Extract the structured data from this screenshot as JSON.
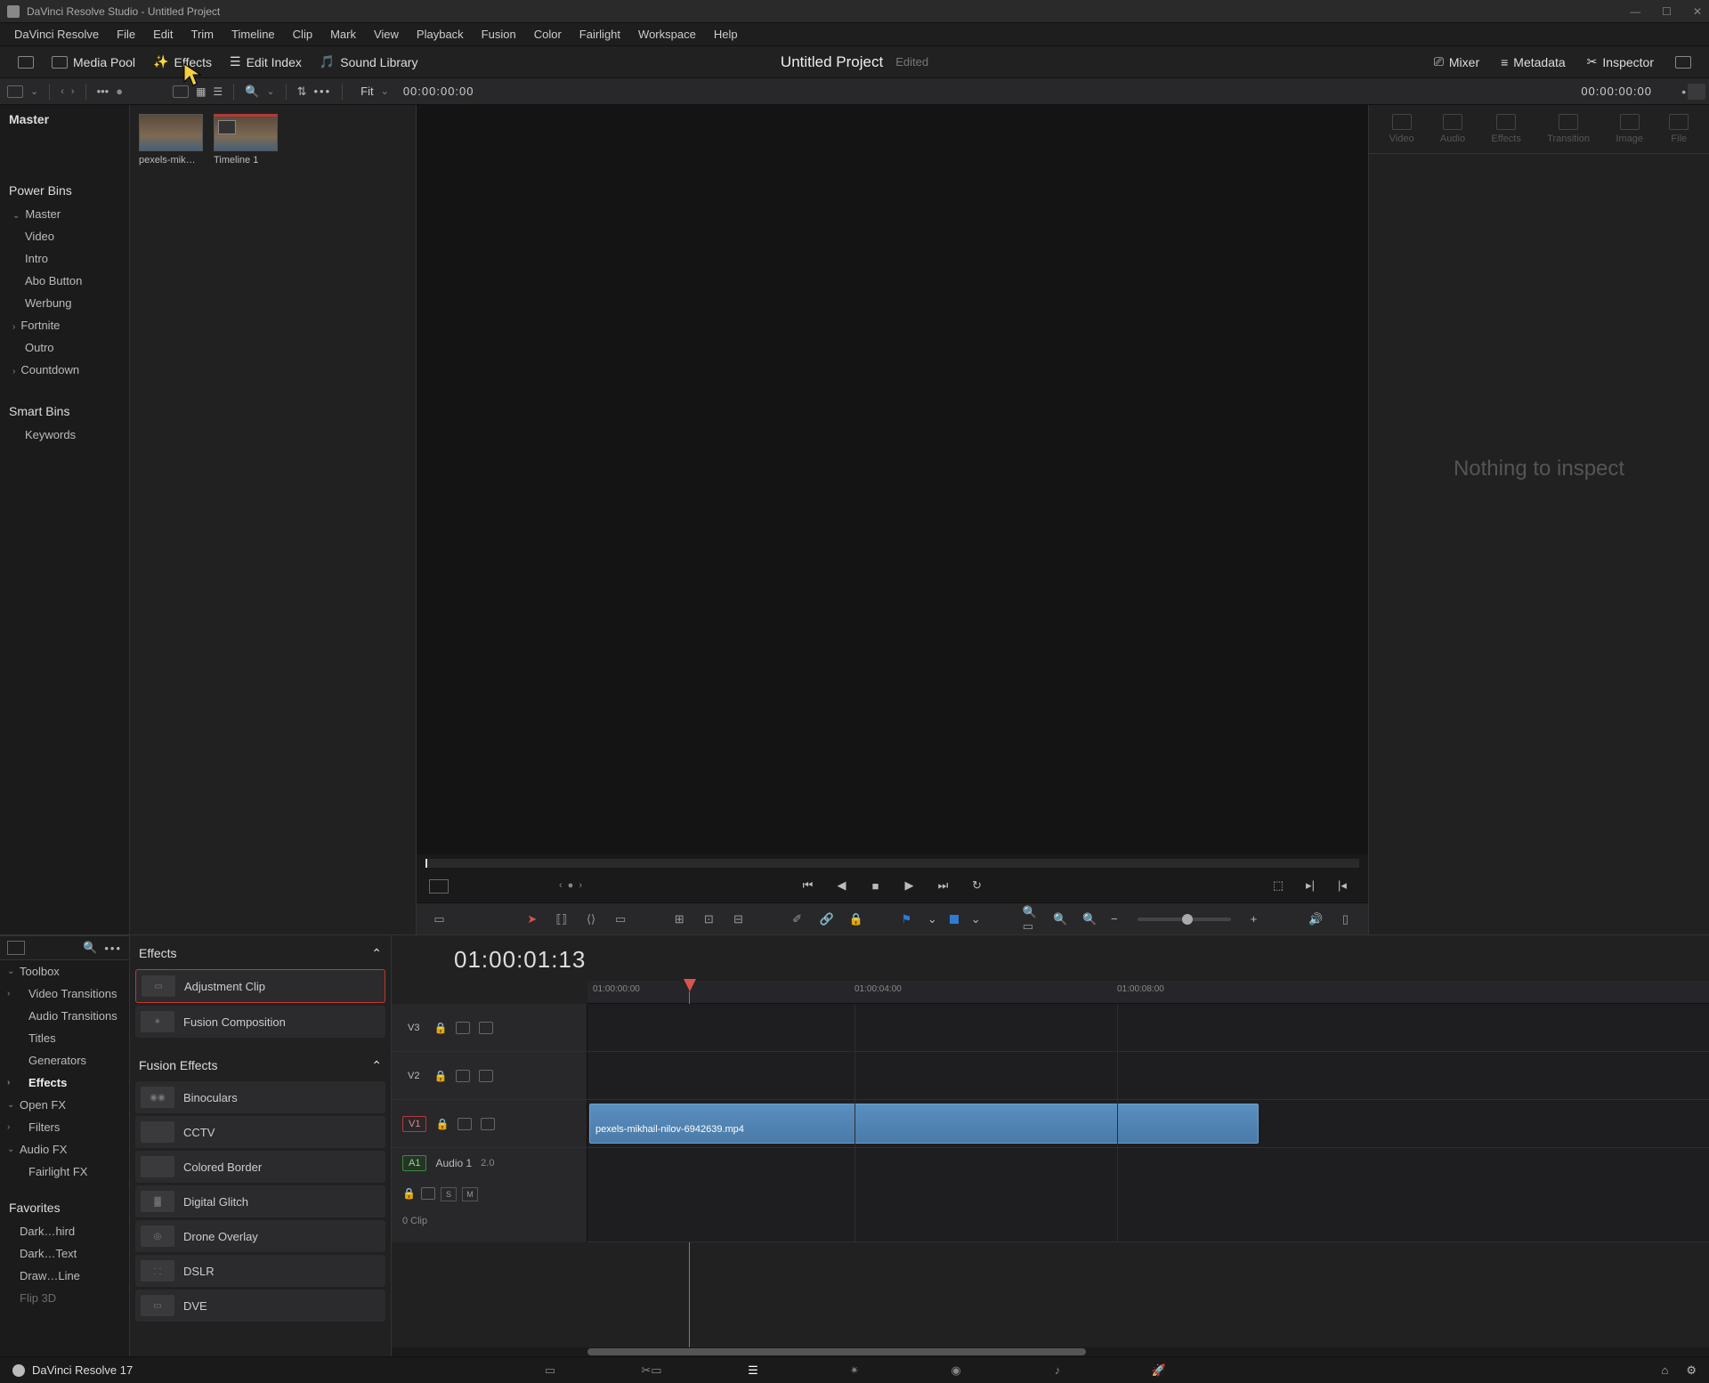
{
  "window": {
    "title": "DaVinci Resolve Studio - Untitled Project"
  },
  "menubar": [
    "DaVinci Resolve",
    "File",
    "Edit",
    "Trim",
    "Timeline",
    "Clip",
    "Mark",
    "View",
    "Playback",
    "Fusion",
    "Color",
    "Fairlight",
    "Workspace",
    "Help"
  ],
  "toolrow": {
    "media_pool": "Media Pool",
    "effects": "Effects",
    "edit_index": "Edit Index",
    "sound_library": "Sound Library",
    "project_title": "Untitled Project",
    "edited": "Edited",
    "mixer": "Mixer",
    "metadata": "Metadata",
    "inspector": "Inspector"
  },
  "toolrow2": {
    "fit": "Fit",
    "timecode_left": "00:00:00:00",
    "timecode_right": "00:00:00:00"
  },
  "bins": {
    "master": "Master",
    "power_bins": "Power Bins",
    "items": [
      "Master",
      "Video",
      "Intro",
      "Abo Button",
      "Werbung",
      "Fortnite",
      "Outro",
      "Countdown"
    ],
    "smart_bins": "Smart Bins",
    "keywords": "Keywords"
  },
  "thumbs": [
    {
      "label": "pexels-mik…"
    },
    {
      "label": "Timeline 1"
    }
  ],
  "inspector": {
    "tabs": [
      "Video",
      "Audio",
      "Effects",
      "Transition",
      "Image",
      "File"
    ],
    "empty": "Nothing to inspect"
  },
  "fxside": {
    "toolbox": "Toolbox",
    "items": [
      "Video Transitions",
      "Audio Transitions",
      "Titles",
      "Generators",
      "Effects"
    ],
    "openfx": "Open FX",
    "filters": "Filters",
    "audiofx": "Audio FX",
    "fairlight": "Fairlight FX",
    "favorites": "Favorites",
    "favs": [
      "Dark…hird",
      "Dark…Text",
      "Draw…Line",
      "Flip 3D"
    ]
  },
  "fxlist": {
    "section1": "Effects",
    "section2": "Fusion Effects",
    "effects": [
      "Adjustment Clip",
      "Fusion Composition"
    ],
    "fusion": [
      "Binoculars",
      "CCTV",
      "Colored Border",
      "Digital Glitch",
      "Drone Overlay",
      "DSLR",
      "DVE"
    ]
  },
  "timeline": {
    "tc": "01:00:01:13",
    "ticks": [
      "01:00:00:00",
      "01:00:04:00",
      "01:00:08:00"
    ],
    "tracks": {
      "v3": "V3",
      "v2": "V2",
      "v1": "V1",
      "a1": "A1",
      "a1name": "Audio 1",
      "a1ch": "2.0",
      "a1clips": "0 Clip"
    },
    "solo": "S",
    "mute": "M",
    "clip_name": "pexels-mikhail-nilov-6942639.mp4"
  },
  "footer": {
    "app": "DaVinci Resolve 17"
  }
}
